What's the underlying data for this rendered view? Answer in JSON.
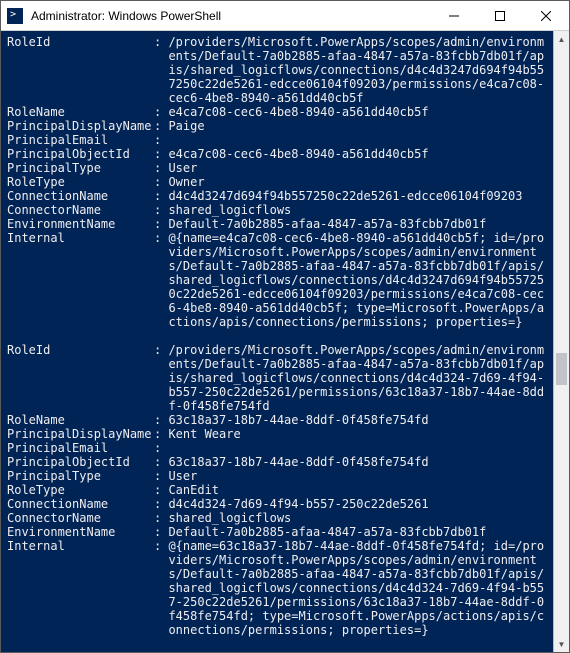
{
  "window": {
    "title": "Administrator: Windows PowerShell"
  },
  "records": [
    {
      "RoleId": "/providers/Microsoft.PowerApps/scopes/admin/environments/Default-7a0b2885-afaa-4847-a57a-83fcbb7db01f/apis/shared_logicflows/connections/d4c4d3247d694f94b557250c22de5261-edcce06104f09203/permissions/e4ca7c08-cec6-4be8-8940-a561dd40cb5f",
      "RoleName": "e4ca7c08-cec6-4be8-8940-a561dd40cb5f",
      "PrincipalDisplayName": "Paige",
      "PrincipalEmail": "",
      "PrincipalObjectId": "e4ca7c08-cec6-4be8-8940-a561dd40cb5f",
      "PrincipalType": "User",
      "RoleType": "Owner",
      "ConnectionName": "d4c4d3247d694f94b557250c22de5261-edcce06104f09203",
      "ConnectorName": "shared_logicflows",
      "EnvironmentName": "Default-7a0b2885-afaa-4847-a57a-83fcbb7db01f",
      "Internal": "@{name=e4ca7c08-cec6-4be8-8940-a561dd40cb5f; id=/providers/Microsoft.PowerApps/scopes/admin/environments/Default-7a0b2885-afaa-4847-a57a-83fcbb7db01f/apis/shared_logicflows/connections/d4c4d3247d694f94b557250c22de5261-edcce06104f09203/permissions/e4ca7c08-cec6-4be8-8940-a561dd40cb5f; type=Microsoft.PowerApps/actions/apis/connections/permissions; properties=}"
    },
    {
      "RoleId": "/providers/Microsoft.PowerApps/scopes/admin/environments/Default-7a0b2885-afaa-4847-a57a-83fcbb7db01f/apis/shared_logicflows/connections/d4c4d324-7d69-4f94-b557-250c22de5261/permissions/63c18a37-18b7-44ae-8ddf-0f458fe754fd",
      "RoleName": "63c18a37-18b7-44ae-8ddf-0f458fe754fd",
      "PrincipalDisplayName": "Kent Weare",
      "PrincipalEmail": "",
      "PrincipalObjectId": "63c18a37-18b7-44ae-8ddf-0f458fe754fd",
      "PrincipalType": "User",
      "RoleType": "CanEdit",
      "ConnectionName": "d4c4d324-7d69-4f94-b557-250c22de5261",
      "ConnectorName": "shared_logicflows",
      "EnvironmentName": "Default-7a0b2885-afaa-4847-a57a-83fcbb7db01f",
      "Internal": "@{name=63c18a37-18b7-44ae-8ddf-0f458fe754fd; id=/providers/Microsoft.PowerApps/scopes/admin/environments/Default-7a0b2885-afaa-4847-a57a-83fcbb7db01f/apis/shared_logicflows/connections/d4c4d324-7d69-4f94-b557-250c22de5261/permissions/63c18a37-18b7-44ae-8ddf-0f458fe754fd; type=Microsoft.PowerApps/actions/apis/connections/permissions; properties=}"
    }
  ],
  "field_order": [
    "RoleId",
    "RoleName",
    "PrincipalDisplayName",
    "PrincipalEmail",
    "PrincipalObjectId",
    "PrincipalType",
    "RoleType",
    "ConnectionName",
    "ConnectorName",
    "EnvironmentName",
    "Internal"
  ]
}
